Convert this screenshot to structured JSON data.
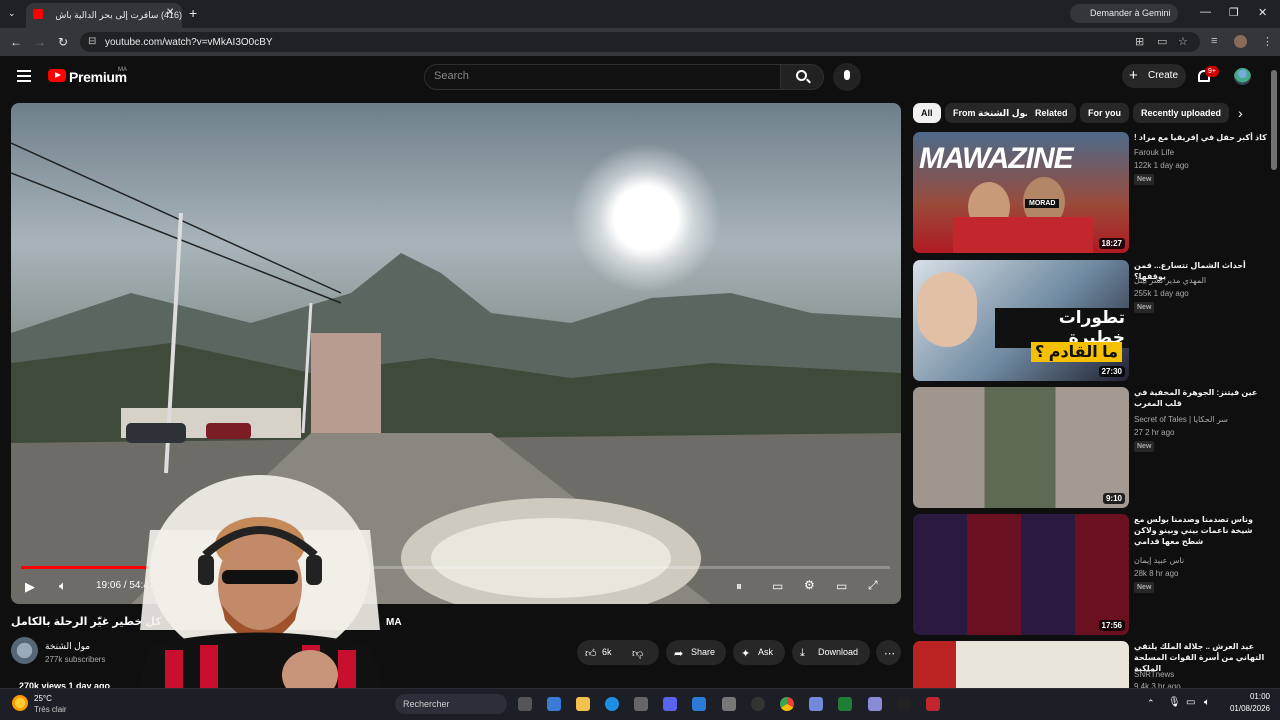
{
  "browser": {
    "tab_title": "(416) سافرت إلى بحر الدالية باش",
    "new_tab": "+",
    "gemini_label": "Demander à Gemini",
    "url": "youtube.com/watch?v=vMkAI3O0cBY"
  },
  "youtube": {
    "logo_text": "Premium",
    "country": "MA",
    "search_placeholder": "Search",
    "create_label": "Create",
    "notif_count": "9+"
  },
  "player": {
    "time": "19:06 / 54:47",
    "progress": 0.349,
    "title": "كل خطير غيّر الرحلة بالكامل",
    "title_badge": "MA",
    "channel": "مول الشنخة",
    "subscribers": "277k subscribers",
    "like_count": "6k",
    "share_label": "Share",
    "ask_label": "Ask",
    "download_label": "Download",
    "views_line": "270k views  1 day ago"
  },
  "chips": [
    "All",
    "From مول الشنخة",
    "Related",
    "For you",
    "Recently uploaded"
  ],
  "recommendations": [
    {
      "title": "كاذ أكبر حفل في إفريقيا مع مراد !",
      "channel": "Farouk Life",
      "meta": "122k   1 day ago",
      "badge": "New",
      "duration": "18:27"
    },
    {
      "title": "أحداث الشمال تتسارع... فمن يوقفها؟",
      "channel": "المهدي مدير نشر بيتل",
      "meta": "255k   1 day ago",
      "badge": "New",
      "duration": "27:30"
    },
    {
      "title": "عين فيتنز: الجوهرة المخفية في قلب المغرب",
      "channel": "Secret of Tales | سر الحكايا",
      "meta": "27   2 hr ago",
      "badge": "New",
      "duration": "9:10"
    },
    {
      "title": "وناس تصدمنا وصدمنا بولس مع شيخة ناعمات بيني وبينو ولاكن شطح معها قدامي",
      "channel": "ناس عبيد إيمان",
      "meta": "28k   8 hr ago",
      "badge": "New",
      "duration": "17:56"
    },
    {
      "title": "عيد العرش .. جلالة الملك يلتقي التهاني من أسرة القوات المسلحة الملكية",
      "channel": "SNRTnews",
      "meta": "9.4k   3 hr ago",
      "badge": "",
      "duration": ""
    }
  ],
  "thumb_text": {
    "t1": "MAWAZINE",
    "t1_label": "MORAD",
    "t2_line1": "تطورات خطيرة",
    "t2_line2": "ما القادم ؟"
  },
  "taskbar": {
    "temp": "25°C",
    "condition": "Très clair",
    "search": "Rechercher",
    "time": "01:00",
    "date": "01/08/2026"
  }
}
